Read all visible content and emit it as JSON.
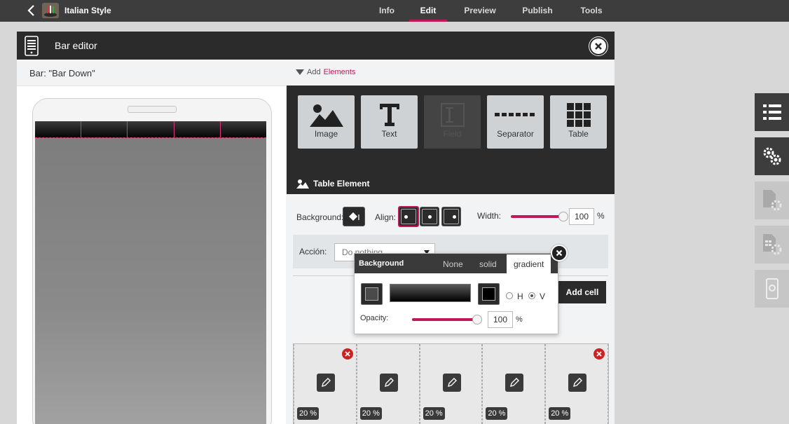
{
  "topbar": {
    "app_title": "Italian Style",
    "nav": [
      {
        "label": "Info",
        "active": false
      },
      {
        "label": "Edit",
        "active": true
      },
      {
        "label": "Preview",
        "active": false
      },
      {
        "label": "Publish",
        "active": false
      },
      {
        "label": "Tools",
        "active": false
      }
    ]
  },
  "editor": {
    "title": "Bar editor",
    "bar_label": "Bar: \"Bar Down\"",
    "add_prefix": "Add ",
    "add_elements": "Elements",
    "tiles": [
      {
        "label": "Image",
        "icon": "image-icon",
        "enabled": true
      },
      {
        "label": "Text",
        "icon": "text-icon",
        "enabled": true
      },
      {
        "label": "Field",
        "icon": "field-icon",
        "enabled": false
      },
      {
        "label": "Separator",
        "icon": "separator-icon",
        "enabled": true
      },
      {
        "label": "Table",
        "icon": "table-icon",
        "enabled": true
      }
    ],
    "section_title": "Table Element",
    "background_label": "Background:",
    "align_label": "Align:",
    "width_label": "Width:",
    "width_value": "100",
    "width_unit": "%",
    "accion_label": "Acción:",
    "accion_value": "Do nothing",
    "add_cell_label": "Add cell",
    "cells": [
      "20 %",
      "20 %",
      "20 %",
      "20 %",
      "20 %"
    ]
  },
  "popup": {
    "title": "Background",
    "tabs": [
      "None",
      "solid",
      "gradient"
    ],
    "active_tab": "gradient",
    "h_label": "H",
    "v_label": "V",
    "opacity_label": "Opacity:",
    "opacity_value": "100",
    "opacity_unit": "%"
  },
  "colors": {
    "accent": "#c2185b",
    "dark": "#2b2b2b",
    "topbar": "#3d3d3d"
  }
}
